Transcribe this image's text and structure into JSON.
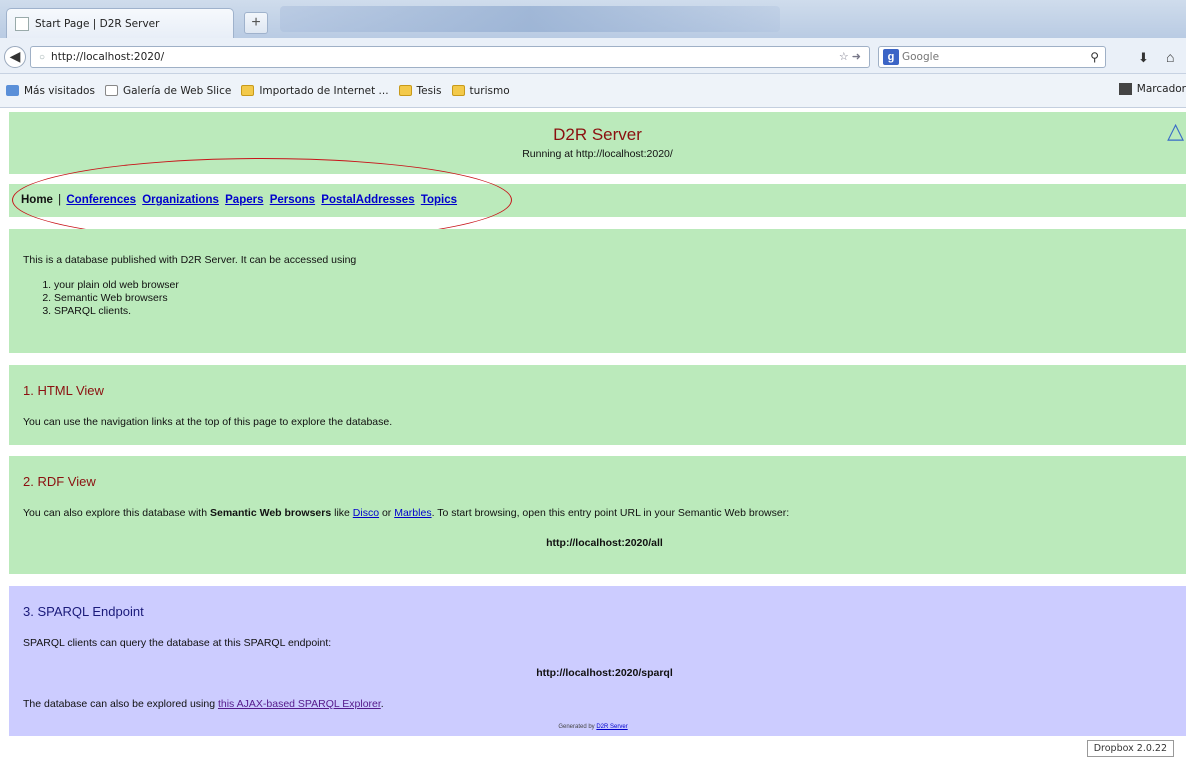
{
  "browser": {
    "tab_title": "Start Page | D2R Server",
    "new_tab": "+",
    "url": "http://localhost:2020/",
    "search_placeholder": "Google",
    "bookmarks": [
      {
        "label": "Más visitados",
        "icon": "blue"
      },
      {
        "label": "Galería de Web Slice",
        "icon": "page"
      },
      {
        "label": "Importado de Internet ...",
        "icon": "folder"
      },
      {
        "label": "Tesis",
        "icon": "folder"
      },
      {
        "label": "turismo",
        "icon": "folder"
      }
    ],
    "bookmarks_right": "Marcador"
  },
  "header": {
    "title": "D2R Server",
    "subtitle": "Running at http://localhost:2020/"
  },
  "nav": {
    "home": "Home",
    "separator": "|",
    "links": [
      "Conferences",
      "Organizations",
      "Papers",
      "Persons",
      "PostalAddresses",
      "Topics"
    ]
  },
  "intro": {
    "text": "This is a database published with D2R Server. It can be accessed using",
    "items": [
      "your plain old web browser",
      "Semantic Web browsers",
      "SPARQL clients."
    ]
  },
  "html_view": {
    "heading": "1. HTML View",
    "text": "You can use the navigation links at the top of this page to explore the database."
  },
  "rdf_view": {
    "heading": "2. RDF View",
    "text_before": "You can also explore this database with ",
    "bold": "Semantic Web browsers",
    "text_like": " like ",
    "link1": "Disco",
    "text_or": " or ",
    "link2": "Marbles",
    "text_after": ". To start browsing, open this entry point URL in your Semantic Web browser:",
    "endpoint": "http://localhost:2020/all"
  },
  "sparql": {
    "heading": "3. SPARQL Endpoint",
    "text": "SPARQL clients can query the database at this SPARQL endpoint:",
    "endpoint": "http://localhost:2020/sparql",
    "text2_before": "The database can also be explored using ",
    "explorer_link": "this AJAX-based SPARQL Explorer",
    "text2_after": "."
  },
  "footer": {
    "generated": "Generated by ",
    "link": "D2R Server"
  },
  "dropbox": "Dropbox 2.0.22"
}
